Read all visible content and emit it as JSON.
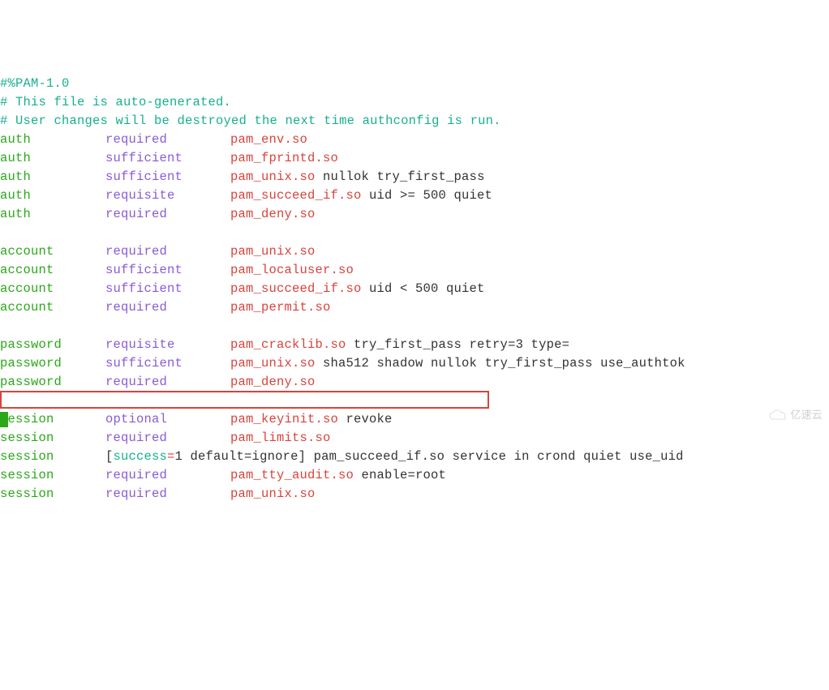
{
  "pam_header": "#%PAM-1.0",
  "comment1": "# This file is auto-generated.",
  "comment2": "# User changes will be destroyed the next time authconfig is run.",
  "rules": [
    {
      "type": "auth",
      "ctrl": "required",
      "module": "pam_env.so",
      "args": ""
    },
    {
      "type": "auth",
      "ctrl": "sufficient",
      "module": "pam_fprintd.so",
      "args": ""
    },
    {
      "type": "auth",
      "ctrl": "sufficient",
      "module": "pam_unix.so",
      "args": " nullok try_first_pass"
    },
    {
      "type": "auth",
      "ctrl": "requisite",
      "module": "pam_succeed_if.so",
      "args": " uid >= 500 quiet"
    },
    {
      "type": "auth",
      "ctrl": "required",
      "module": "pam_deny.so",
      "args": ""
    },
    {
      "blank": true
    },
    {
      "type": "account",
      "ctrl": "required",
      "module": "pam_unix.so",
      "args": ""
    },
    {
      "type": "account",
      "ctrl": "sufficient",
      "module": "pam_localuser.so",
      "args": ""
    },
    {
      "type": "account",
      "ctrl": "sufficient",
      "module": "pam_succeed_if.so",
      "args": " uid < 500 quiet"
    },
    {
      "type": "account",
      "ctrl": "required",
      "module": "pam_permit.so",
      "args": ""
    },
    {
      "blank": true
    },
    {
      "type": "password",
      "ctrl": "requisite",
      "module": "pam_cracklib.so",
      "args": " try_first_pass retry=3 type="
    },
    {
      "type": "password",
      "ctrl": "sufficient",
      "module": "pam_unix.so",
      "args": " sha512 shadow nullok try_first_pass use_authtok"
    },
    {
      "type": "password",
      "ctrl": "required",
      "module": "pam_deny.so",
      "args": ""
    },
    {
      "blank": true
    },
    {
      "type": "session",
      "ctrl": "optional",
      "module": "pam_keyinit.so",
      "args": " revoke"
    },
    {
      "type": "session",
      "ctrl": "required",
      "module": "pam_limits.so",
      "args": ""
    },
    {
      "type": "session",
      "ctrl_raw": true,
      "bracket_open": "[",
      "success": "success",
      "eq": "=",
      "rest": "1 default=ignore] pam_succeed_if.so service in crond quiet use_uid"
    },
    {
      "type": "session",
      "ctrl": "required",
      "module": "pam_tty_audit.so",
      "args": " enable=root",
      "highlighted": true
    },
    {
      "type": "session",
      "ctrl": "required",
      "module": "pam_unix.so",
      "args": ""
    }
  ],
  "watermark": "亿速云"
}
